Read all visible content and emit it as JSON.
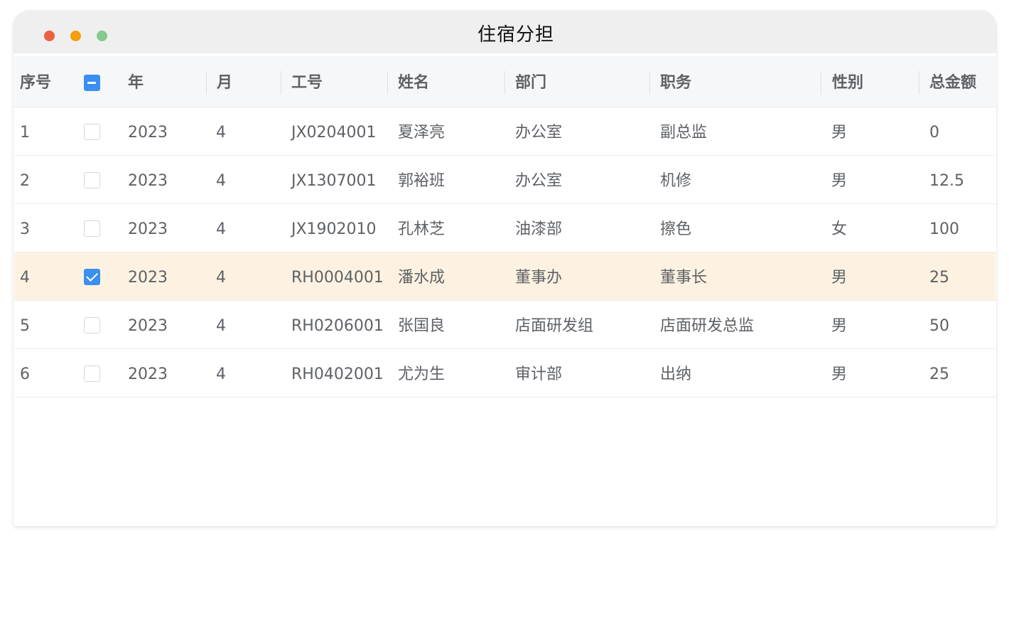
{
  "window": {
    "title": "住宿分担",
    "colors": {
      "close": "#ec5f40",
      "minimize": "#f2a00b",
      "zoom": "#86c98c"
    }
  },
  "table": {
    "headers": {
      "index": "序号",
      "year": "年",
      "month": "月",
      "employee_id": "工号",
      "name": "姓名",
      "department": "部门",
      "position": "职务",
      "gender": "性别",
      "total_amount": "总金额"
    },
    "select_all_state": "indeterminate",
    "selected_row_color": "#fdf2e1",
    "rows": [
      {
        "index": "1",
        "checked": false,
        "year": "2023",
        "month": "4",
        "employee_id": "JX0204001",
        "name": "夏泽亮",
        "department": "办公室",
        "position": "副总监",
        "gender": "男",
        "total_amount": "0"
      },
      {
        "index": "2",
        "checked": false,
        "year": "2023",
        "month": "4",
        "employee_id": "JX1307001",
        "name": "郭裕班",
        "department": "办公室",
        "position": "机修",
        "gender": "男",
        "total_amount": "12.5"
      },
      {
        "index": "3",
        "checked": false,
        "year": "2023",
        "month": "4",
        "employee_id": "JX1902010",
        "name": "孔林芝",
        "department": "油漆部",
        "position": "擦色",
        "gender": "女",
        "total_amount": "100"
      },
      {
        "index": "4",
        "checked": true,
        "year": "2023",
        "month": "4",
        "employee_id": "RH0004001",
        "name": "潘水成",
        "department": "董事办",
        "position": "董事长",
        "gender": "男",
        "total_amount": "25"
      },
      {
        "index": "5",
        "checked": false,
        "year": "2023",
        "month": "4",
        "employee_id": "RH0206001",
        "name": "张国良",
        "department": "店面研发组",
        "position": "店面研发总监",
        "gender": "男",
        "total_amount": "50"
      },
      {
        "index": "6",
        "checked": false,
        "year": "2023",
        "month": "4",
        "employee_id": "RH0402001",
        "name": "尤为生",
        "department": "审计部",
        "position": "出纳",
        "gender": "男",
        "total_amount": "25"
      }
    ]
  }
}
